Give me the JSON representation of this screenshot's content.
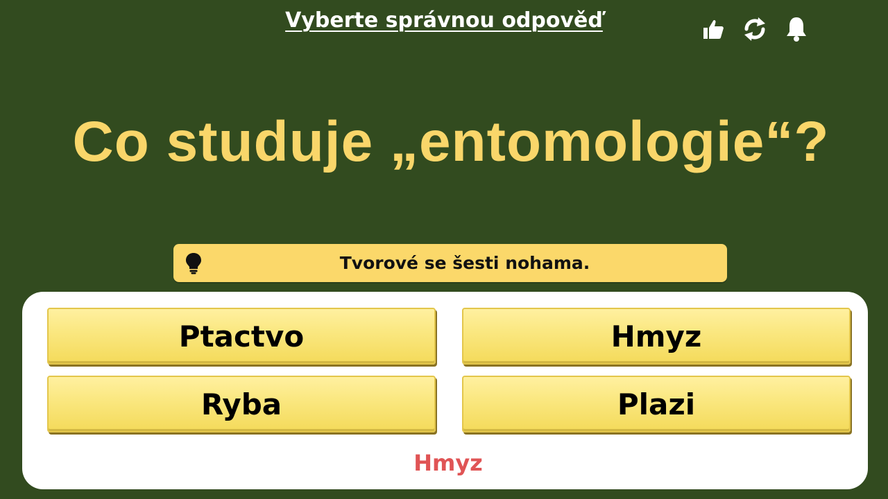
{
  "instruction": "Vyberte správnou odpověď",
  "toolbar": {
    "icons": [
      "thumbs-up-icon",
      "refresh-icon",
      "bell-icon"
    ]
  },
  "question": "Co studuje „entomologie“?",
  "hint": {
    "icon": "lightbulb-icon",
    "text": "Tvorové se šesti nohama."
  },
  "answers": [
    {
      "label": "Ptactvo"
    },
    {
      "label": "Hmyz"
    },
    {
      "label": "Ryba"
    },
    {
      "label": "Plazi"
    }
  ],
  "result": "Hmyz",
  "colors": {
    "background": "#324b1f",
    "question_text": "#f9d66a",
    "hint_bar": "#fbd86a",
    "answer_button": "#fbe985",
    "result_text": "#e05455"
  }
}
